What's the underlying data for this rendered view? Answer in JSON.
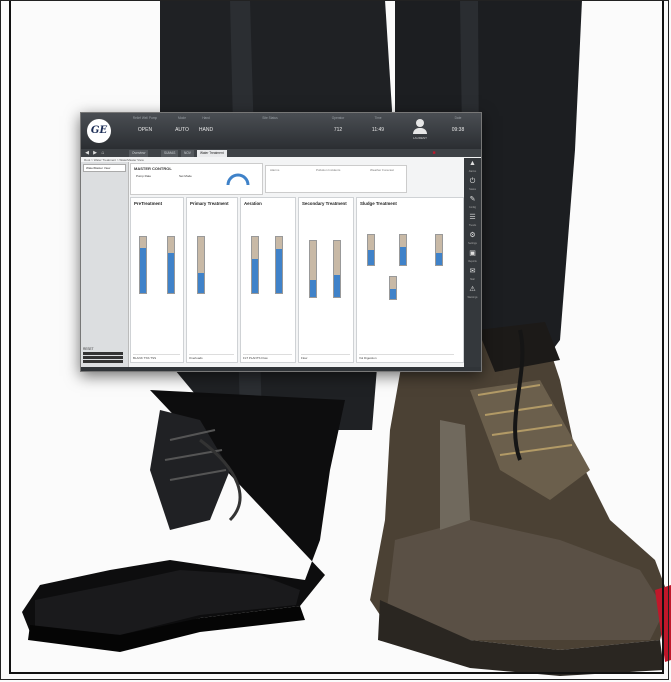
{
  "hmi": {
    "logo_text": "GE",
    "top": {
      "cell1_label": "Relief Well Pump",
      "cell1_value": "OPEN",
      "cell2_label": "Mode",
      "cell2_value": "AUTO",
      "cell3_label": "Hand",
      "cell3_value": "HAND",
      "cell4_label": "Site Status",
      "cell5_label": "Operator",
      "cell5_value": "712",
      "cell6_label": "Time",
      "cell6_value": "11:49",
      "user_name": "LAURENT",
      "clock_label": "Date",
      "clock_value": "09:38"
    },
    "nav": {
      "back": "◀",
      "forward": "▶",
      "home": "⌂"
    },
    "tabs": [
      "Overview",
      "SUMAS",
      "NOV",
      "Water Treatment"
    ],
    "breadcrumb": "Root > Water Treatment > WaterMaster View",
    "left_select": "WaterMaster View",
    "reset_label": "RESET",
    "control": {
      "title": "MASTER CONTROL",
      "setting1": "Pump Rate",
      "setting2": "Set Mode"
    },
    "panel": {
      "title1": "Alarms",
      "title2": "Pollution Incidents",
      "title3": "Weather Forecast"
    },
    "columns": [
      {
        "title": "PreTreatment",
        "foot": "BLANK  TSS  TSS"
      },
      {
        "title": "Primary Treatment",
        "foot": "Overloads"
      },
      {
        "title": "Aeration",
        "foot": "FLT PLANTS  Flow"
      },
      {
        "title": "Secondary Treatment",
        "foot": "Flow"
      },
      {
        "title": "Sludge Treatment",
        "foot": "Vol  Digestion"
      }
    ],
    "rail": [
      {
        "icon": "▲",
        "label": "Alarms"
      },
      {
        "icon": "⏻",
        "label": "Status"
      },
      {
        "icon": "✎",
        "label": "Config"
      },
      {
        "icon": "☰",
        "label": "Trends"
      },
      {
        "icon": "⚙",
        "label": "Settings"
      },
      {
        "icon": "▣",
        "label": "Reports"
      },
      {
        "icon": "✉",
        "label": "Mail"
      },
      {
        "icon": "⚠",
        "label": "Warnings"
      }
    ]
  },
  "colors": {
    "screen_bg": "#f3f4f5",
    "header": "#2b2e32",
    "water": "#3f82c9",
    "trouser": "#1f2124",
    "shoe_leather": "#0d0d0e",
    "boot": "#4b4134"
  }
}
